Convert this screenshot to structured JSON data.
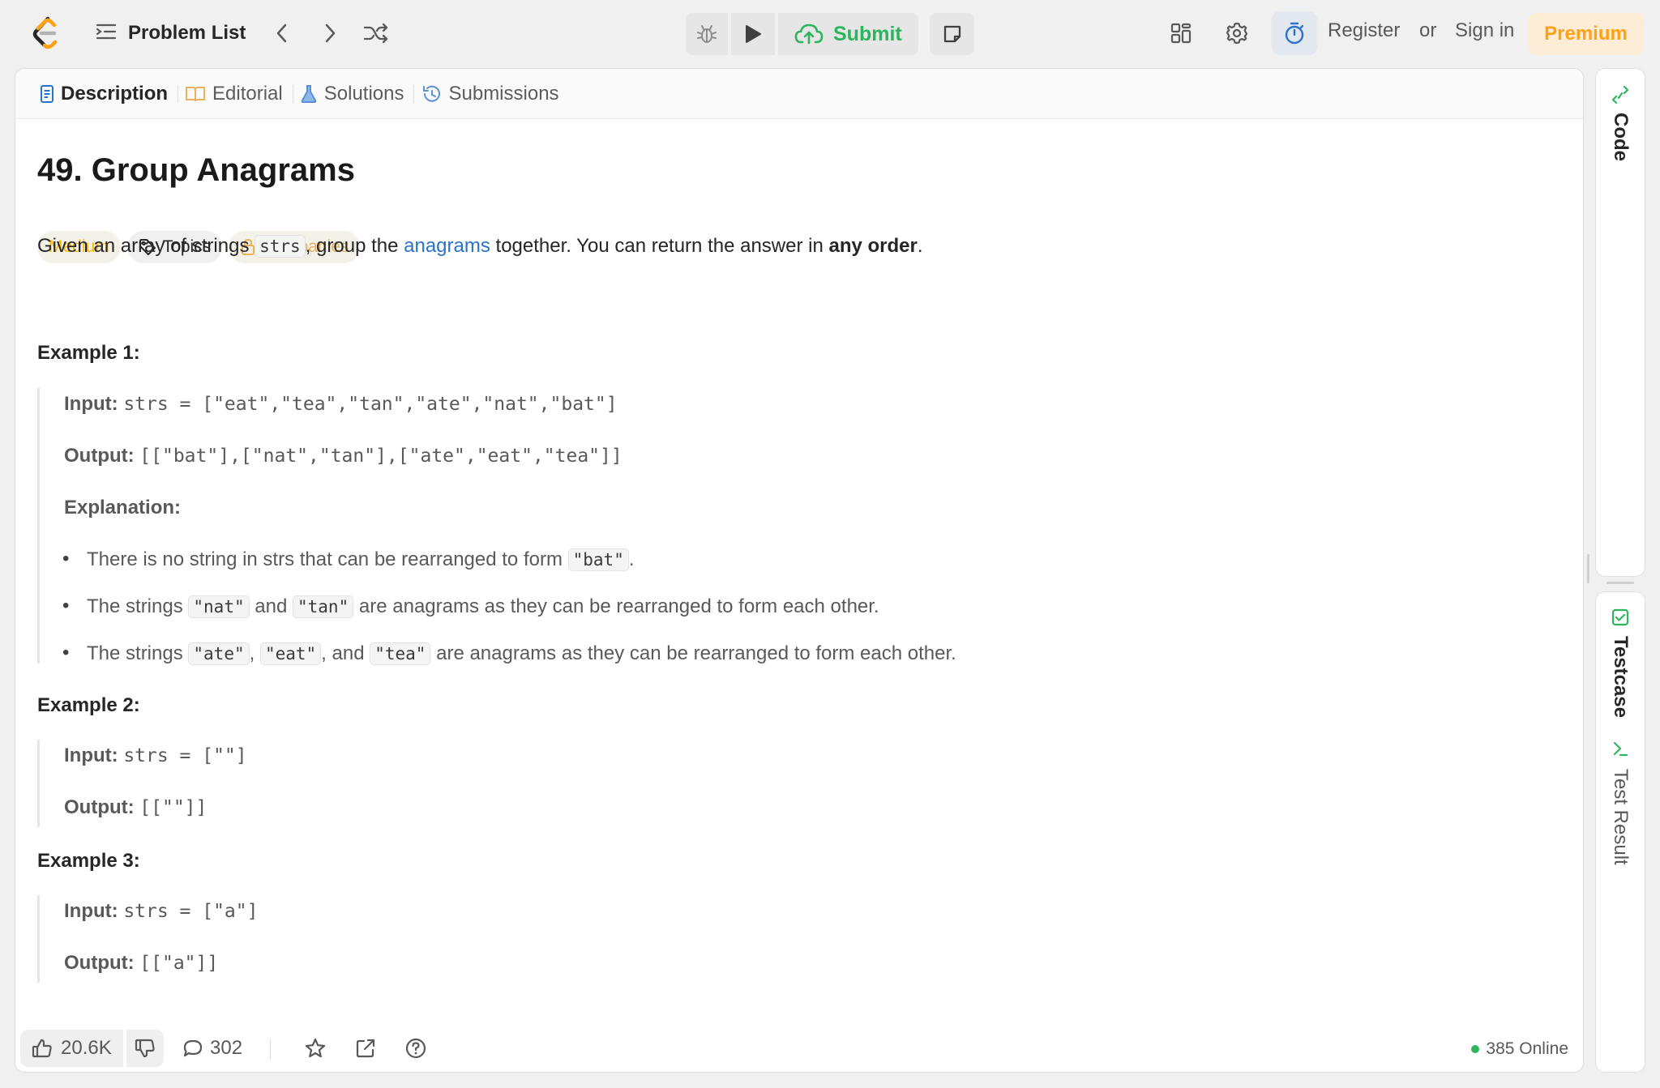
{
  "topbar": {
    "problem_list_label": "Problem List",
    "submit_label": "Submit",
    "register_label": "Register",
    "or_label": "or",
    "signin_label": "Sign in",
    "premium_label": "Premium"
  },
  "tabs": [
    {
      "label": "Description",
      "icon": "description-icon",
      "active": true
    },
    {
      "label": "Editorial",
      "icon": "book-icon",
      "active": false
    },
    {
      "label": "Solutions",
      "icon": "flask-icon",
      "active": false
    },
    {
      "label": "Submissions",
      "icon": "history-icon",
      "active": false
    }
  ],
  "problem": {
    "title": "49. Group Anagrams",
    "difficulty": "Medium",
    "topics_label": "Topics",
    "companies_label": "Companies",
    "desc": {
      "p1": "Given an array of strings ",
      "code": "strs",
      "p2": ", group the ",
      "link": "anagrams",
      "p3": " together. You can return the answer in ",
      "bold": "any order",
      "p4": "."
    }
  },
  "examples": {
    "ex1": {
      "heading": "Example 1:",
      "input_label": "Input:",
      "input_value": "strs = [\"eat\",\"tea\",\"tan\",\"ate\",\"nat\",\"bat\"]",
      "output_label": "Output:",
      "output_value": "[[\"bat\"],[\"nat\",\"tan\"],[\"ate\",\"eat\",\"tea\"]]",
      "explanation_label": "Explanation:",
      "b1": {
        "t1": "There is no string in strs that can be rearranged to form ",
        "c1": "\"bat\"",
        "t2": "."
      },
      "b2": {
        "t1": "The strings ",
        "c1": "\"nat\"",
        "t2": " and ",
        "c2": "\"tan\"",
        "t3": " are anagrams as they can be rearranged to form each other."
      },
      "b3": {
        "t1": "The strings ",
        "c1": "\"ate\"",
        "t2": ", ",
        "c2": "\"eat\"",
        "t3": ", and ",
        "c3": "\"tea\"",
        "t4": " are anagrams as they can be rearranged to form each other."
      }
    },
    "ex2": {
      "heading": "Example 2:",
      "input_label": "Input:",
      "input_value": "strs = [\"\"]",
      "output_label": "Output:",
      "output_value": "[[\"\"]]"
    },
    "ex3": {
      "heading": "Example 3:",
      "input_label": "Input:",
      "input_value": "strs = [\"a\"]",
      "output_label": "Output:",
      "output_value": "[[\"a\"]]"
    }
  },
  "footer": {
    "likes": "20.6K",
    "comments": "302",
    "online_count": "385 Online"
  },
  "side": {
    "code_label": "Code",
    "testcase_label": "Testcase",
    "test_result_label": "Test Result"
  },
  "colors": {
    "accent_green": "#2db55d",
    "premium_orange": "#ffa116",
    "difficulty_medium": "#ffb800",
    "link_blue": "#2a73cc"
  }
}
